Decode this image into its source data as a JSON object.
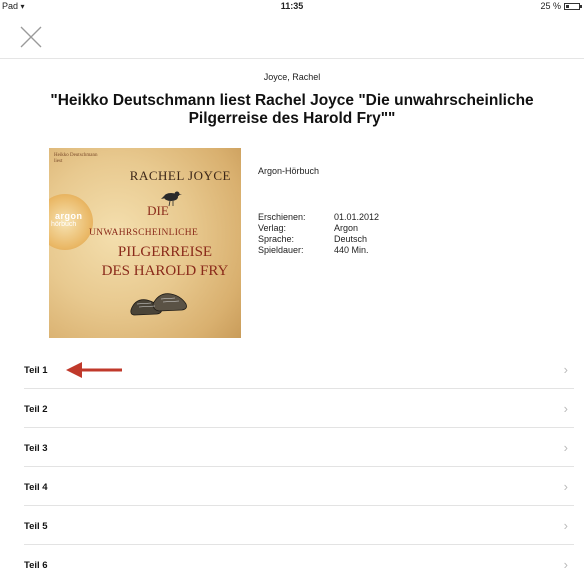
{
  "status": {
    "device": "Pad",
    "time": "11:35",
    "battery": "25 %",
    "battery_level": 0.25
  },
  "book": {
    "author": "Joyce, Rachel",
    "title": "\"Heikko Deutschmann liest Rachel Joyce \"Die unwahrscheinliche Pilgerreise des Harold Fry\"\"",
    "publisher_line": "Argon-Hörbuch",
    "metadata": [
      {
        "key": "Erschienen:",
        "value": "01.01.2012"
      },
      {
        "key": "Verlag:",
        "value": "Argon"
      },
      {
        "key": "Sprache:",
        "value": "Deutsch"
      },
      {
        "key": "Spieldauer:",
        "value": "440 Min."
      }
    ]
  },
  "cover": {
    "narrator_line1": "Heikko Deutschmann",
    "narrator_line2": "liest",
    "author": "RACHEL JOYCE",
    "logo_line1": "argon",
    "logo_line2": "hörbuch",
    "title_line1": "DIE",
    "title_line2": "UNWAHRSCHEINLICHE",
    "title_line3": "PILGERREISE",
    "title_line4": "DES HAROLD FRY"
  },
  "parts": [
    {
      "label": "Teil 1"
    },
    {
      "label": "Teil 2"
    },
    {
      "label": "Teil 3"
    },
    {
      "label": "Teil 4"
    },
    {
      "label": "Teil 5"
    },
    {
      "label": "Teil 6"
    }
  ],
  "colors": {
    "annotation_arrow": "#c0392b",
    "separator": "#e3e3e3",
    "chevron": "#bbbbbb"
  },
  "icons": {
    "close": "close-icon",
    "chevron": "chevron-right-icon",
    "wifi": "wifi-icon",
    "battery": "battery-icon"
  }
}
